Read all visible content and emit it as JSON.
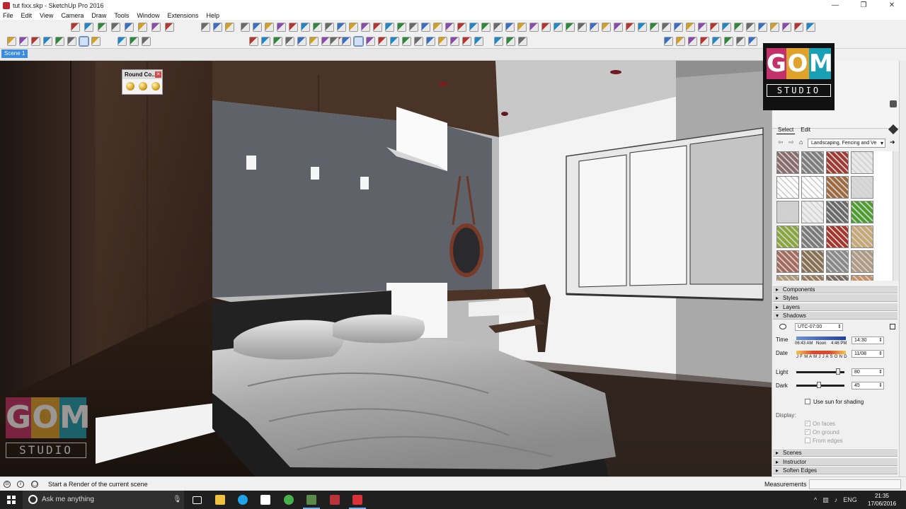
{
  "window": {
    "title": "tut fixx.skp - SketchUp Pro 2016",
    "minimize": "—",
    "maximize": "❐",
    "close": "✕"
  },
  "menu": [
    "File",
    "Edit",
    "View",
    "Camera",
    "Draw",
    "Tools",
    "Window",
    "Extensions",
    "Help"
  ],
  "scene_tab": "Scene 1",
  "round_corner_panel": {
    "title": "Round Co..."
  },
  "logo": {
    "letters": [
      "G",
      "O",
      "M"
    ],
    "studio": "STUDIO",
    "colors": [
      "#c4306a",
      "#e0a22a",
      "#1aa0b4"
    ]
  },
  "tray": {
    "tabs": [
      "Select",
      "Edit"
    ],
    "library": "Landscaping, Fencing and Ve",
    "sections_top": [
      "Components",
      "Styles",
      "Layers"
    ],
    "shadows": {
      "title": "Shadows",
      "timezone": "UTC-07:00",
      "time_label": "Time",
      "time_marks": [
        "06:43 AM",
        "Noon",
        "4:46 PM"
      ],
      "time_value": "14:30",
      "date_label": "Date",
      "months": "J F M A M J J A S O N D",
      "date_value": "11/08",
      "light_label": "Light",
      "light_value": "80",
      "dark_label": "Dark",
      "dark_value": "45",
      "use_sun": "Use sun for shading",
      "display_label": "Display:",
      "on_faces": "On faces",
      "on_ground": "On ground",
      "from_edges": "From edges"
    },
    "sections_bottom": [
      "Scenes",
      "Instructor",
      "Soften Edges"
    ]
  },
  "status": {
    "message": "Start a Render of the current scene",
    "measurements_label": "Measurements"
  },
  "taskbar": {
    "search_placeholder": "Ask me anything",
    "lang": "ENG",
    "time": "21:35",
    "date": "17/06/2016"
  }
}
